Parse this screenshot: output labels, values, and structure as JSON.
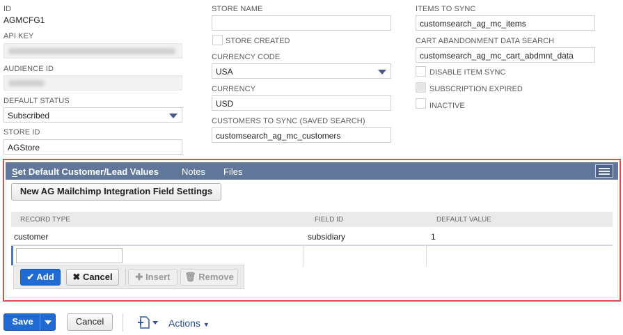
{
  "colors": {
    "accent": "#1f6ad3",
    "tabbar": "#607799",
    "highlight": "#e34a4a"
  },
  "fields": {
    "id": {
      "label": "ID",
      "value": "AGMCFG1"
    },
    "api_key": {
      "label": "API KEY"
    },
    "audience_id": {
      "label": "AUDIENCE ID"
    },
    "default_status": {
      "label": "DEFAULT STATUS",
      "value": "Subscribed"
    },
    "store_id": {
      "label": "STORE ID",
      "value": "AGStore"
    },
    "store_name": {
      "label": "STORE NAME",
      "value": ""
    },
    "store_created": {
      "label": "STORE CREATED",
      "checked": false
    },
    "currency_code": {
      "label": "CURRENCY CODE",
      "value": "USA"
    },
    "currency": {
      "label": "CURRENCY",
      "value": "USD"
    },
    "customers_to_sync": {
      "label": "CUSTOMERS TO SYNC (SAVED SEARCH)",
      "value": "customsearch_ag_mc_customers"
    },
    "items_to_sync": {
      "label": "ITEMS TO SYNC",
      "value": "customsearch_ag_mc_items"
    },
    "cart_abandonment": {
      "label": "CART ABANDONMENT DATA SEARCH",
      "value": "customsearch_ag_mc_cart_abdmnt_data"
    },
    "disable_item_sync": {
      "label": "DISABLE ITEM SYNC",
      "checked": false
    },
    "subscription_expired": {
      "label": "SUBSCRIPTION EXPIRED",
      "checked": false
    },
    "inactive": {
      "label": "INACTIVE",
      "checked": false
    }
  },
  "subtabs": {
    "tabs": [
      {
        "label": "Set Default Customer/Lead Values",
        "active": true
      },
      {
        "label": "Notes",
        "active": false
      },
      {
        "label": "Files",
        "active": false
      }
    ],
    "new_button": "New AG Mailchimp Integration Field Settings",
    "columns": [
      "RECORD TYPE",
      "FIELD ID",
      "DEFAULT VALUE"
    ],
    "rows": [
      {
        "record_type": "customer",
        "field_id": "subsidiary",
        "default_value": "1"
      }
    ],
    "edit_buttons": {
      "add": "Add",
      "cancel": "Cancel",
      "insert": "Insert",
      "remove": "Remove"
    }
  },
  "footer": {
    "save": "Save",
    "cancel": "Cancel",
    "actions": "Actions"
  },
  "icons": [
    "check-icon",
    "x-icon",
    "plus-icon",
    "trash-icon",
    "dropdown-arrow-icon",
    "menu-icon",
    "add-document-icon"
  ]
}
